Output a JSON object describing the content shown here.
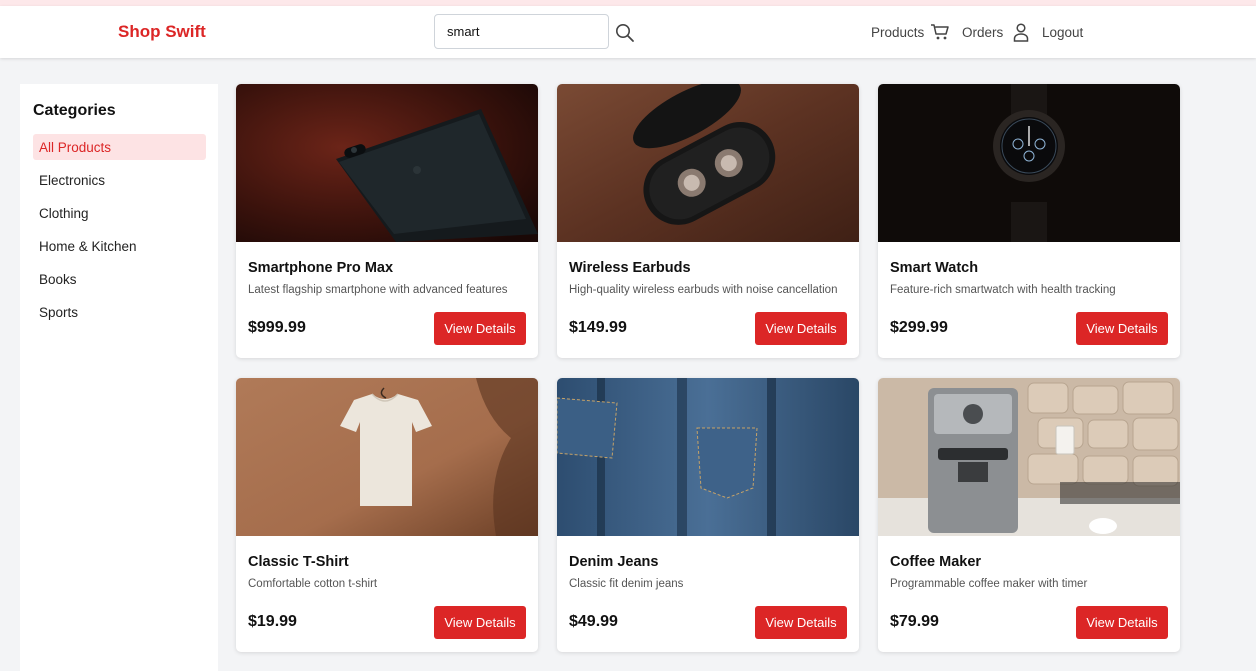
{
  "brand": {
    "name": "Shop Swift",
    "color": "#dc2626"
  },
  "search": {
    "value": "smart",
    "icon": "search-icon"
  },
  "nav": {
    "products": "Products",
    "cart_icon": "cart-icon",
    "orders": "Orders",
    "user_icon": "user-icon",
    "logout": "Logout"
  },
  "categories": {
    "title": "Categories",
    "items": [
      {
        "label": "All Products",
        "active": true
      },
      {
        "label": "Electronics",
        "active": false
      },
      {
        "label": "Clothing",
        "active": false
      },
      {
        "label": "Home & Kitchen",
        "active": false
      },
      {
        "label": "Books",
        "active": false
      },
      {
        "label": "Sports",
        "active": false
      }
    ]
  },
  "products": [
    {
      "name": "Smartphone Pro Max",
      "description": "Latest flagship smartphone with advanced features",
      "price": "$999.99",
      "button": "View Details",
      "image": "smartphone-photo"
    },
    {
      "name": "Wireless Earbuds",
      "description": "High-quality wireless earbuds with noise cancellation",
      "price": "$149.99",
      "button": "View Details",
      "image": "earbuds-photo"
    },
    {
      "name": "Smart Watch",
      "description": "Feature-rich smartwatch with health tracking",
      "price": "$299.99",
      "button": "View Details",
      "image": "smartwatch-photo"
    },
    {
      "name": "Classic T-Shirt",
      "description": "Comfortable cotton t-shirt",
      "price": "$19.99",
      "button": "View Details",
      "image": "tshirt-photo"
    },
    {
      "name": "Denim Jeans",
      "description": "Classic fit denim jeans",
      "price": "$49.99",
      "button": "View Details",
      "image": "jeans-photo"
    },
    {
      "name": "Coffee Maker",
      "description": "Programmable coffee maker with timer",
      "price": "$79.99",
      "button": "View Details",
      "image": "coffee-maker-photo"
    }
  ]
}
